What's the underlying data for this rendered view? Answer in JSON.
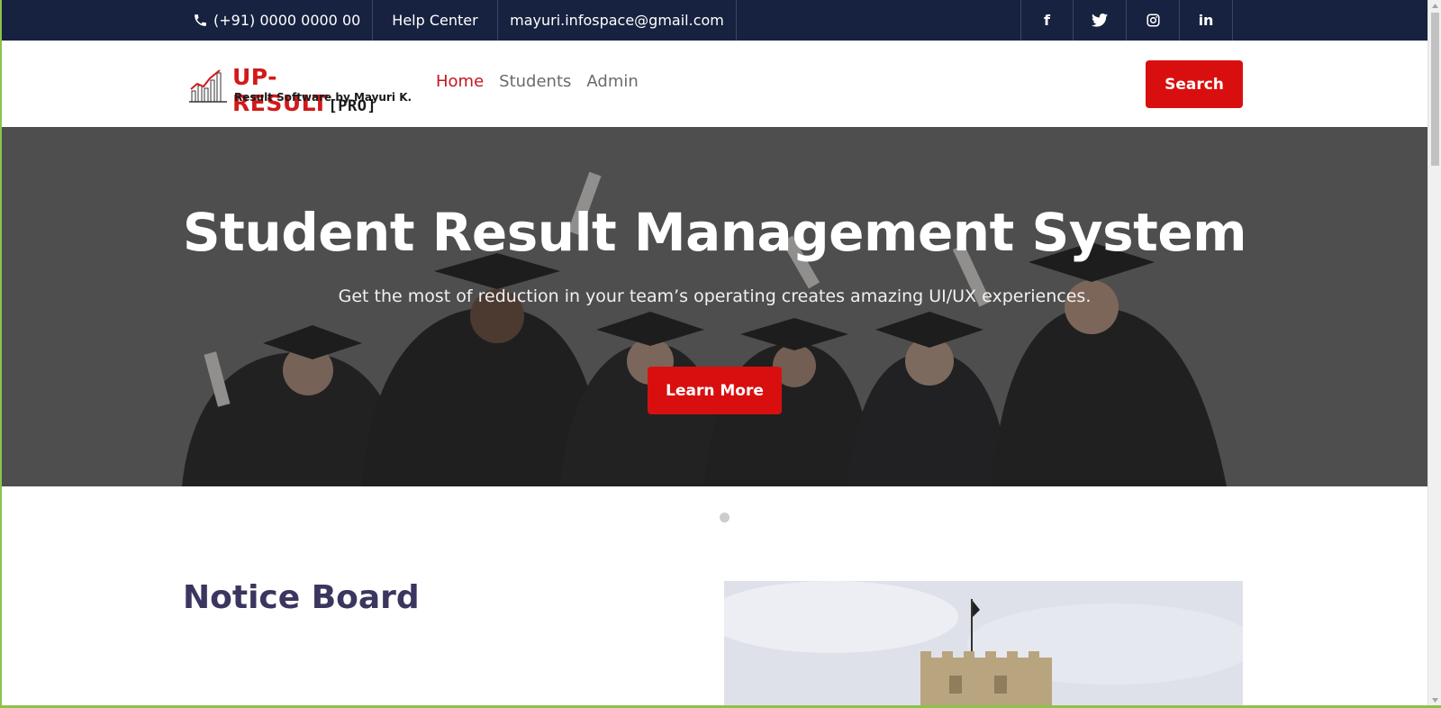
{
  "topbar": {
    "phone": "(+91) 0000 0000 00",
    "help": "Help Center",
    "email": "mayuri.infospace@gmail.com",
    "social": [
      {
        "icon": "facebook-icon",
        "glyph": "f"
      },
      {
        "icon": "twitter-icon",
        "glyph": "🐦"
      },
      {
        "icon": "instagram-icon",
        "glyph": "◎"
      },
      {
        "icon": "linkedin-icon",
        "glyph": "in"
      }
    ]
  },
  "logo": {
    "title": "UP-RESULT",
    "badge": "[PRO]",
    "subtitle": "Result Software by Mayuri K."
  },
  "nav": {
    "home": "Home",
    "students": "Students",
    "admin": "Admin"
  },
  "search_label": "Search",
  "hero": {
    "title": "Student Result Management System",
    "subtitle": "Get the most of reduction in your team’s operating creates amazing UI/UX experiences.",
    "button": "Learn More"
  },
  "notice": {
    "title": "Notice Board"
  },
  "colors": {
    "topbar": "#172240",
    "accent_red": "#d90f0f",
    "nav_active": "#c2171d",
    "heading": "#3a3660"
  }
}
